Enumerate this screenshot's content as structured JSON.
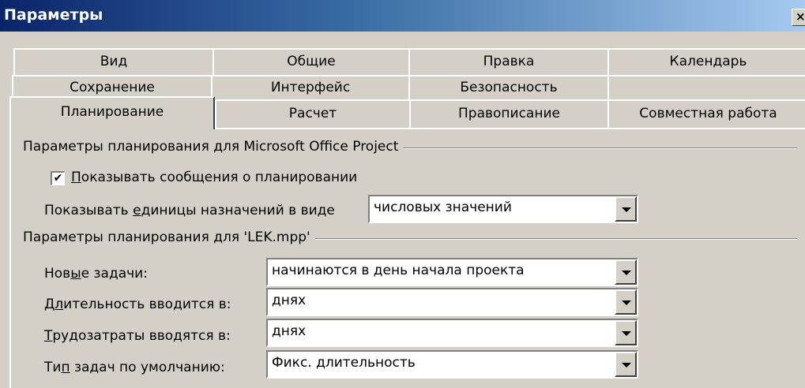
{
  "window": {
    "title": "Параметры",
    "close_label": "×"
  },
  "tabs": {
    "row1": [
      "Вид",
      "Общие",
      "Правка",
      "Календарь"
    ],
    "row2": [
      "Сохранение",
      "Интерфейс",
      "Безопасность"
    ],
    "row3": [
      "Планирование",
      "Расчет",
      "Правописание",
      "Совместная работа"
    ],
    "active": "Планирование"
  },
  "group1": {
    "label": "Параметры планирования для Microsoft Office Project",
    "checkbox": {
      "checked": true,
      "mark": "✔",
      "label_u": "П",
      "label_rest": "оказывать сообщения о планировании"
    },
    "units": {
      "label_pre": "Показывать ",
      "label_u": "е",
      "label_post": "диницы назначений в виде",
      "value": "числовых значений"
    }
  },
  "group2": {
    "label": "Параметры планирования для 'LEK.mpp'",
    "new_tasks": {
      "label_pre": "Нов",
      "label_u": "ы",
      "label_post": "е задачи:",
      "value": "начинаются в день начала проекта"
    },
    "duration": {
      "label_pre": "Д",
      "label_u": "л",
      "label_post": "ительность вводится в:",
      "value": "днях"
    },
    "work": {
      "label_pre": "",
      "label_u": "Т",
      "label_post": "рудозатраты вводятся в:",
      "value": "днях"
    },
    "task_type": {
      "label_pre": "Ти",
      "label_u": "п",
      "label_post": " задач по умолчанию:",
      "value": "Фикс. длительность"
    }
  }
}
